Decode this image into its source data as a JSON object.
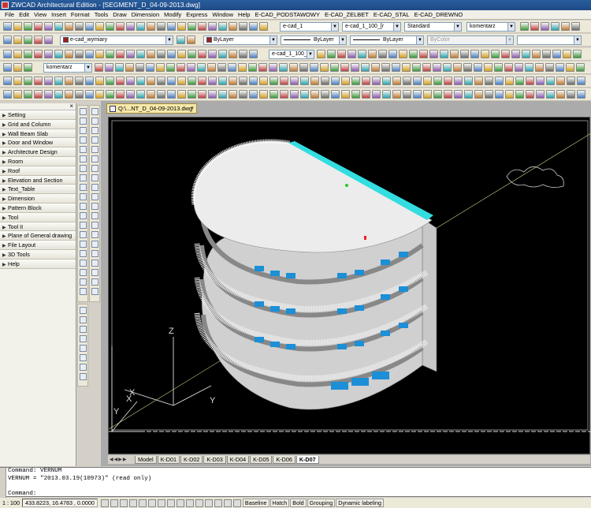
{
  "app": {
    "title": "ZWCAD Architectural Edition - [SEGMENT_D_04-09-2013.dwg]"
  },
  "menu": [
    "File",
    "Edit",
    "View",
    "Insert",
    "Format",
    "Tools",
    "Draw",
    "Dimension",
    "Modify",
    "Express",
    "Window",
    "Help",
    "E-CAD_PODSTAWOWY",
    "E-CAD_ZELBET",
    "E-CAD_STAL",
    "E-CAD_DREWNO"
  ],
  "toolbar": {
    "layer_combo_1": "e-cad_1",
    "layer_combo_2": "e-cad_1_100_[r",
    "text_style": "Standard",
    "dim_style": "komentarz",
    "current_layer": "e-cad_wymiary",
    "color": "ByLayer",
    "linetype": "ByLayer",
    "lineweight": "ByLayer",
    "plotstyle": "ByColor",
    "layer_combo_3": "e-cad_1_100_[r",
    "multileader_style": "komentarz",
    "accent_color": "#1d4a86"
  },
  "side_panel": {
    "items": [
      "Setting",
      "Grid and Column",
      "Wall Beam Slab",
      "Door and Window",
      "Architecture Design",
      "Room",
      "Roof",
      "Elevation and Section",
      "Text_Table",
      "Dimension",
      "Pattern Block",
      "Tool",
      "Tool II",
      "Plane of General drawing",
      "File Layout",
      "3D Tools",
      "Help"
    ]
  },
  "document_tab": {
    "title": "Q:\\...NT_D_04-09-2013.dwg"
  },
  "canvas": {
    "ucs_z": "Z",
    "ucs_y": "Y",
    "ucs_x": "X",
    "ucs_y2": "Y",
    "ucs_x2": "X",
    "background": "#000000",
    "roof_rail_color": "#33dde0"
  },
  "layout_tabs": [
    "Model",
    "K-D01",
    "K-D02",
    "K-D03",
    "K-D04",
    "K-D05",
    "K-D06",
    "K-D07"
  ],
  "command": {
    "lines": [
      "Command: VERNUM",
      "VERNUM = \"2013.03.19(10973)\" (read only)",
      "",
      "Command:"
    ]
  },
  "status": {
    "scale": "1 : 100",
    "coords": "433.8223, 16.4783 , 0.0000",
    "buttons": [
      "Baseline",
      "Hatch",
      "Bold",
      "Grouping",
      "Dynamic labeling"
    ]
  }
}
